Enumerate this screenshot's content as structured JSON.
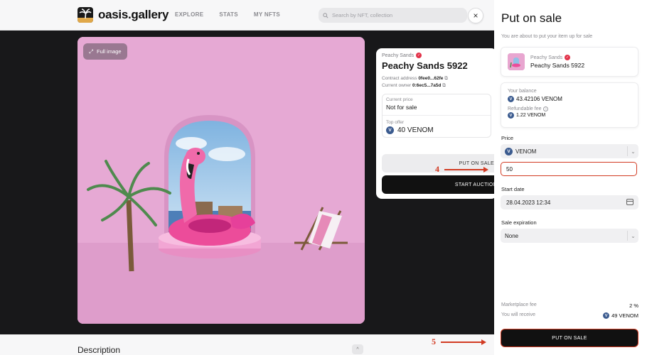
{
  "header": {
    "logo_text": "oasis.gallery",
    "nav": [
      "EXPLORE",
      "STATS",
      "MY NFTS"
    ],
    "search_placeholder": "Search by NFT, collection",
    "close": "×"
  },
  "nft": {
    "full_image_label": "Full image"
  },
  "details": {
    "collection": "Peachy Sands",
    "name": "Peachy Sands 5922",
    "contract_label": "Contract address",
    "contract_value": "0fee0...62fe",
    "owner_label": "Current owner",
    "owner_value": "0:6ec5...7a5d",
    "current_price_label": "Current price",
    "current_price_value": "Not for sale",
    "top_offer_label": "Top offer",
    "top_offer_value": "40 VENOM",
    "put_on_sale_label": "PUT ON SALE",
    "start_auction_label": "START AUCTION"
  },
  "description": {
    "title": "Description",
    "toggle": "^"
  },
  "annotations": {
    "step4": "4",
    "step5": "5"
  },
  "panel": {
    "title": "Put on sale",
    "subtitle": "You are about to put your item up for sale",
    "item_collection": "Peachy Sands",
    "item_name": "Peachy Sands 5922",
    "balance_label": "Your balance",
    "balance_value": "43.42106 VENOM",
    "refundable_label": "Refundable fee",
    "refundable_value": "1.22 VENOM",
    "price_label": "Price",
    "currency": "VENOM",
    "price_value": "50",
    "start_date_label": "Start date",
    "start_date_value": "28.04.2023 12:34",
    "expiration_label": "Sale expiration",
    "expiration_value": "None",
    "marketplace_fee_label": "Marketplace fee",
    "marketplace_fee_value": "2 %",
    "receive_label": "You will receive",
    "receive_value": "49 VENOM",
    "submit_label": "PUT ON SALE"
  },
  "colors": {
    "accent_red": "#d23b23",
    "nft_background": "#e5a8d3",
    "venom_icon": "#3b5b8f"
  }
}
